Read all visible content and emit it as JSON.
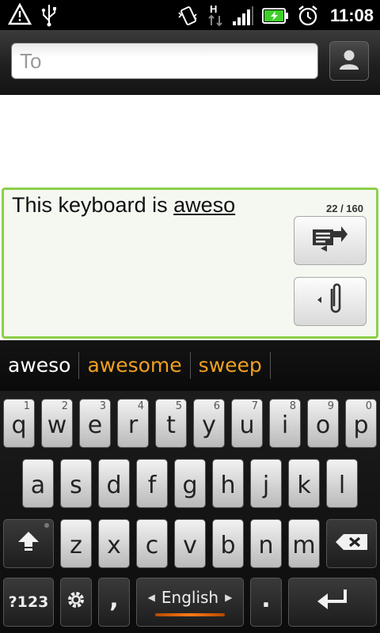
{
  "status_bar": {
    "time": "11:08",
    "network_type": "H",
    "icons": [
      "warning-icon",
      "usb-icon",
      "vibrate-icon",
      "data-transfer-icon",
      "signal-icon",
      "battery-charging-icon",
      "alarm-icon"
    ],
    "battery_color": "#3fcf2a"
  },
  "to_field": {
    "placeholder": "To"
  },
  "compose": {
    "text_before": "This keyboard is ",
    "composing_word": "aweso",
    "counter": "22 / 160",
    "accent_color": "#8ccf4a"
  },
  "suggestions": {
    "items": [
      "aweso",
      "awesome",
      "sweep"
    ],
    "alt_color": "#f0a020"
  },
  "keyboard": {
    "row1": [
      {
        "label": "q",
        "num": "1"
      },
      {
        "label": "w",
        "num": "2"
      },
      {
        "label": "e",
        "num": "3"
      },
      {
        "label": "r",
        "num": "4"
      },
      {
        "label": "t",
        "num": "5"
      },
      {
        "label": "y",
        "num": "6"
      },
      {
        "label": "u",
        "num": "7"
      },
      {
        "label": "i",
        "num": "8"
      },
      {
        "label": "o",
        "num": "9"
      },
      {
        "label": "p",
        "num": "0"
      }
    ],
    "row2": [
      "a",
      "s",
      "d",
      "f",
      "g",
      "h",
      "j",
      "k",
      "l"
    ],
    "row3": [
      "z",
      "x",
      "c",
      "v",
      "b",
      "n",
      "m"
    ],
    "symbols_label": "?123",
    "comma_label": ",",
    "period_label": ".",
    "language_label": "English"
  }
}
